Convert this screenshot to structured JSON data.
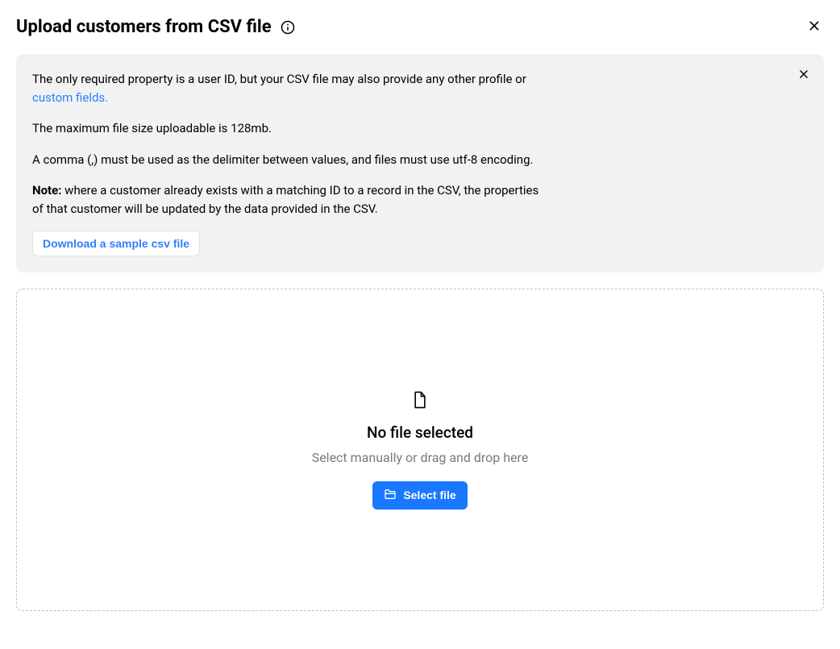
{
  "header": {
    "title": "Upload customers from CSV file"
  },
  "info_panel": {
    "para1_prefix": "The only required property is a user ID, but your CSV file may also provide any other profile or ",
    "para1_link": "custom fields.",
    "para2": "The maximum file size uploadable is 128mb.",
    "para3": "A comma (,) must be used as the delimiter between values, and files must use utf-8 encoding.",
    "note_label": "Note:",
    "para4_rest": " where a customer already exists with a matching ID to a record in the CSV, the properties of that customer will be updated by the data provided in the CSV.",
    "download_button": "Download a sample csv file"
  },
  "dropzone": {
    "title": "No file selected",
    "subtitle": "Select manually or drag and drop here",
    "button": "Select file"
  }
}
